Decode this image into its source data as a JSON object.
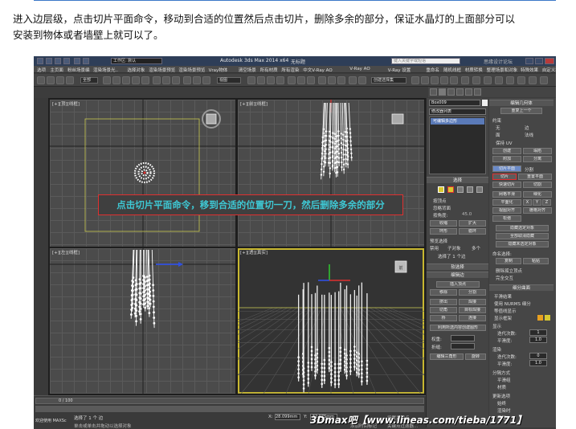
{
  "caption": {
    "line1": "进入边层级，点击切片平面命令，移动到合适的位置然后点击切片，删除多余的部分，保证水晶灯的上面部分可以",
    "line2": "安装到物体或者墙壁上就可以了。"
  },
  "window": {
    "title": "Autodesk 3ds Max  2014 x64",
    "subtitle": "无标题",
    "workspace": "工作区: 默认",
    "search_placeholder": "键入关键字或短语",
    "site_watermark": "思缘设计论坛"
  },
  "menu": [
    "选项",
    "主页面",
    "粉丝场景编",
    "渲染场景光..",
    "选择对象",
    "渲染场景预览",
    "渲染场景预览",
    "Vray物体",
    "清空场景",
    "所有材质",
    "所有渲染",
    "中文V-Ray AO",
    "V-Ray AO",
    "V-Ray 设置",
    "重命名",
    "随机线框",
    "材质转换",
    "整理场景和对象",
    "特殊效果",
    "自定义批量",
    "一键Vray光"
  ],
  "toolbar": {
    "selection_set": "全部",
    "view_dropdown": "视图",
    "create_dropdown": "创建选择集"
  },
  "viewports": {
    "top": "[+][顶][线框]",
    "front": "[+][前][线框]",
    "left": "[+][左][线框]",
    "persp": "[+][透][真实]"
  },
  "annotation": "点击切片平面命令，移到合适的位置切一刀，然后删除多余的部分",
  "command_panel": {
    "object_name": "Box009",
    "modifier_list": "修改器列表",
    "stack_item": "可编辑多边形",
    "selection_header": "选择",
    "by_vertex": "按顶点",
    "ignore_backfacing": "忽略背面",
    "by_angle": "按角度:",
    "angle_value": "45.0",
    "shrink": "收缩",
    "grow": "扩大",
    "ring": "环形",
    "loop": "循环",
    "preview_selection": "预览选择",
    "preview_off": "禁用",
    "preview_subobj": "子对象",
    "preview_multi": "多个",
    "selected_count": "选择了 1 个边",
    "soft_selection": "软选择",
    "edit_edges": "编辑边",
    "insert_vertex": "插入顶点",
    "remove": "移除",
    "split": "分割",
    "extrude": "挤出",
    "weld": "焊接",
    "chamfer": "切角",
    "target_weld": "目标焊接",
    "bridge": "桥",
    "connect": "连接",
    "create_shape": "利用所选内容创建图形",
    "weight": "权重:",
    "crease": "折缝:",
    "edit_tri": "编辑三角形",
    "turn": "旋转"
  },
  "right_panel": {
    "edit_geometry": "编辑几何体",
    "repeat_last": "重复上一个",
    "constraints": "约束",
    "none": "无",
    "edge": "边",
    "face": "面",
    "normal": "法线",
    "preserve_uvs": "保持 UV",
    "create": "创建",
    "collapse": "塌陷",
    "attach": "附加",
    "detach": "分离",
    "slice_plane": "切片平面",
    "split": "分割",
    "slice": "切片",
    "reset_plane": "重置平面",
    "quickslice": "快速切片",
    "cut": "切割",
    "meshsmooth": "网格平滑",
    "tessellate": "细化",
    "make_planar": "平面化",
    "x": "X",
    "y": "Y",
    "z": "Z",
    "view_align": "视图对齐",
    "grid_align": "栅格对齐",
    "relax": "松弛",
    "hide_selected": "隐藏选定对象",
    "unhide_all": "全部取消隐藏",
    "hide_unselected": "隐藏未选定对象",
    "named_selections": "命名选择:",
    "copy": "复制",
    "paste": "粘贴",
    "delete_isolated": "删除孤立顶点",
    "full_interactivity": "完全交互",
    "subdivision_surface": "细分曲面",
    "smooth_result": "平滑结果",
    "use_nurms": "使用 NURMS 细分",
    "isoline_display": "等值线显示",
    "show_cage": "显示框架",
    "display": "显示",
    "iterations": "迭代次数:",
    "iterations_value": "1",
    "smoothness": "平滑度:",
    "smoothness_value": "1.0",
    "render": "渲染",
    "render_iterations_value": "0",
    "render_smoothness_value": "1.0",
    "separate_by": "分隔方式",
    "smoothing_groups": "平滑组",
    "materials": "材质",
    "update_options": "更新选项",
    "always": "始终",
    "when_rendering": "渲染时",
    "manually": "手动"
  },
  "status": {
    "frame": "0 / 100",
    "selected_text": "选择了 1 个 边",
    "prompt": "单击或单击并拖动以选择对象",
    "script_label": "欢迎使用 MAXSc",
    "x_label": "X:",
    "x_value": "28.099mm",
    "y_label": "Y:",
    "y_value": "-32.075mm",
    "add_time_tag": "添加时间标记",
    "set_key": "设置关键点",
    "key_filter": "关键点过滤器..."
  },
  "watermark": "3Dmax吧【www.lineas.com/tieba/1771】"
}
